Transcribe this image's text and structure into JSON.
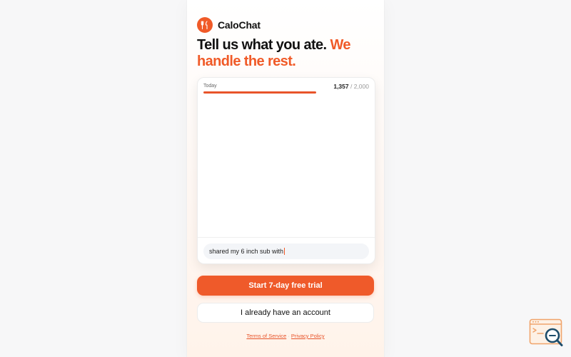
{
  "app": {
    "name": "CaloChat",
    "logo_icon": "fork-knife-icon",
    "accent": "#f05a28"
  },
  "hero": {
    "headline_main": "Tell us what you ate.",
    "headline_accent": "We handle the rest."
  },
  "tracker": {
    "day_label": "Today",
    "calories_current": "1,357",
    "calories_separator": " / ",
    "calories_goal": "2,000",
    "progress_fraction": 0.68
  },
  "chat": {
    "input_value": "shared my 6 inch sub with"
  },
  "actions": {
    "primary_label": "Start 7-day free trial",
    "secondary_label": "I already have an account"
  },
  "legal": {
    "terms": "Terms of Service",
    "separator": " · ",
    "privacy": "Privacy Policy"
  },
  "corner_widget": {
    "icon": "browser-search-icon"
  }
}
